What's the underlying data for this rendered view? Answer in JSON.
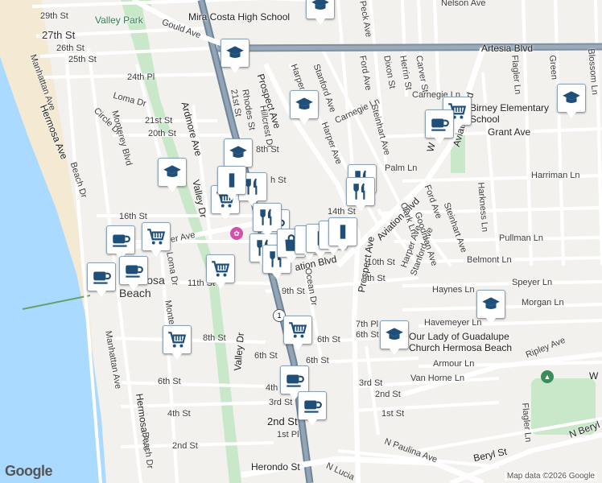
{
  "map": {
    "labels": {
      "street_29th": "29th St",
      "street_27th": "27th St",
      "street_26th": "26th St",
      "street_25th": "25th St",
      "street_24th_pl": "24th Pl",
      "street_21st": "21st St",
      "street_20th": "20th St",
      "street_18th": "8th St",
      "street_16th": "16th St",
      "street_14th": "14th St",
      "street_11th": "11th St",
      "street_10th": "10th St",
      "street_9th_a": "9th St",
      "street_9th_b": "9th St",
      "street_8th": "8th St",
      "street_7th_pl": "7th Pl",
      "street_6th_a": "6th St",
      "street_6th_b": "6th St",
      "street_6th_c": "6th St",
      "street_6th_d": "6th St",
      "street_4th_a": "4th St",
      "street_4th_b": "4th",
      "street_3rd_a": "3rd St",
      "street_3rd_b": "3rd St",
      "street_2nd_a": "2nd St",
      "street_2nd_b": "2nd St",
      "street_2nd_c": "2nd St",
      "street_1st_a": "1st St",
      "street_1st_pl": "1st Pl",
      "valley_park": "Valley Park",
      "mira_costa": "Mira Costa High School",
      "nelson_ave": "Nelson Ave",
      "gould_ave": "Gould Ave",
      "artesia_blvd": "Artesia Blvd",
      "prospect_ave_a": "Prospect Ave",
      "prospect_ave_b": "Prospect Ave",
      "harper_ave_a": "Harper Ave",
      "harper_ave_b": "Harper Ave",
      "harper_ave_c": "Harper Ave",
      "stanford_ave_a": "Stanford Ave",
      "stanford_ave_b": "Stanford Ave",
      "ford_ave_a": "Ford Ave",
      "ford_ave_b": "Ford Ave",
      "peck_ave": "Peck Ave",
      "dixon_st": "Dixon St",
      "herrin_st": "Herrin St",
      "carver_st": "Carver St",
      "carnegie_ln_a": "Carnegie Ln",
      "carnegie_ln_b": "Carnegie Ln",
      "steinhart_ave_a": "Steinhart Ave",
      "steinhart_ave_b": "Steinhart Ave",
      "aviation_blvd_a": "Aviation Blvd",
      "aviation_blvd_b": "Aviation Blvd",
      "aviation_blvd_c": "ation Blvd",
      "flagler_ln_a": "Flagler Ln",
      "flagler_ln_b": "Flagler Ln",
      "blossom_ln": "Blossom Ln",
      "green": "Green",
      "birney": "Birney Elementary School",
      "grant_ave": "Grant Ave",
      "palm_ln": "Palm Ln",
      "harriman_ln": "Harriman Ln",
      "harkness_ln": "Harkness Ln",
      "pullman_ln": "Pullman Ln",
      "belmont_ln": "Belmont Ln",
      "speyer_ln": "Speyer Ln",
      "haynes_ln": "Haynes Ln",
      "morgan_ln": "Morgan Ln",
      "havemeyer_ln": "Havemeyer Ln",
      "guadalupe": "Our Lady of Guadalupe Church Hermosa Beach",
      "ripley_ave": "Ripley Ave",
      "armour_ln": "Armour Ln",
      "van_horne_ln": "Van Horne Ln",
      "goodman_ave": "Goodman Ave",
      "clark_ln": "Clark Ln",
      "ocean_dr": "Ocean Dr",
      "pier_ave": "Pier Ave",
      "ardmore_ave": "Ardmore Ave",
      "valley_dr_a": "Valley Dr",
      "valley_dr_b": "Valley Dr",
      "hillcrest_dr": "Hillcrest Dr",
      "rhodes_st": "Rhodes St",
      "manhattan_ave_a": "Manhattan Ave",
      "manhattan_ave_b": "Manhattan Ave",
      "hermosa_ave_a": "Hermosa Ave",
      "hermosa_ave_b": "Hermosa Ave",
      "loma_dr_a": "Loma Dr",
      "loma_dr_b": "Loma Dr",
      "circle_dr": "Circle Dr",
      "monterey_blvd": "Monterey Blvd",
      "monte": "Monte",
      "beach_dr_a": "Beach Dr",
      "beach_dr_b": "Beach Dr",
      "hermosa_beach": "Hermosa Beach",
      "herondo_st": "Herondo St",
      "beryl_st": "Beryl St",
      "n_beryl_st": "N Beryl St",
      "n_paulina_ave": "N Paulina Ave",
      "n_lucia": "N Lucia",
      "w_label": "W",
      "w_label_b": "W",
      "hillcrest_h": "h St",
      "shield_1": "1"
    },
    "google_logo": "Google",
    "attribution": "Map data ©2026 Google",
    "colors": {
      "marker_blue": "#1f4e79",
      "artesia": "#7d8fa0",
      "highway": "#6f8497",
      "water": "#aadaff",
      "park": "#c9e8c9",
      "sand": "#f4ead4"
    }
  }
}
